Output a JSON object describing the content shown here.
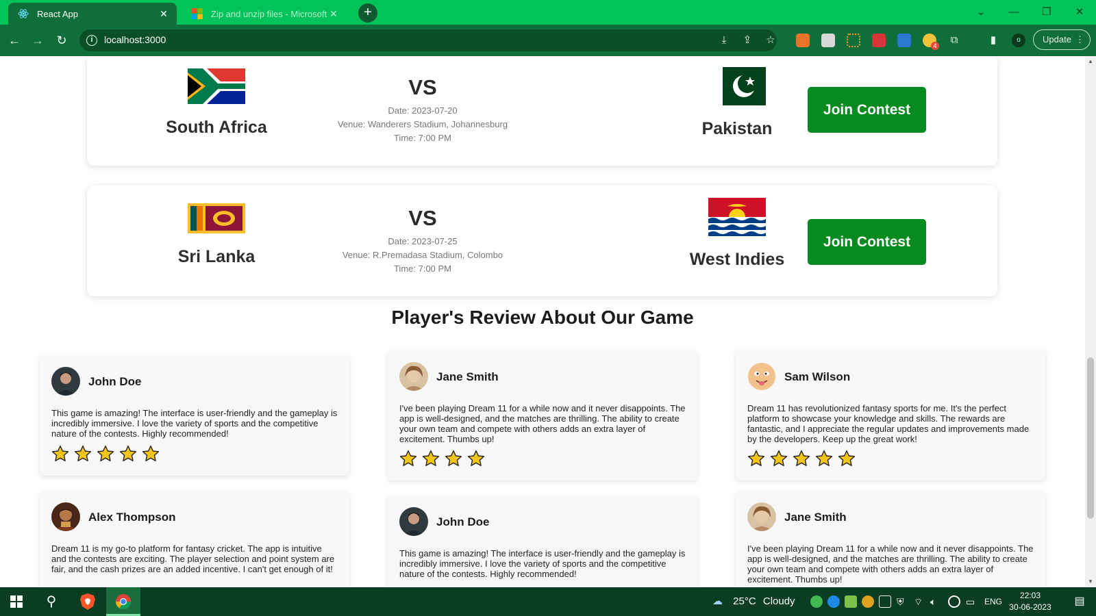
{
  "browser": {
    "tabs": [
      {
        "title": "React App",
        "active": true
      },
      {
        "title": "Zip and unzip files - Microsoft",
        "active": false
      }
    ],
    "new_tab_symbol": "+",
    "url": "localhost:3000",
    "update_label": "Update",
    "profile_initial": "o",
    "extension_badge": "4"
  },
  "matches": [
    {
      "team1": "South Africa",
      "team2": "Pakistan",
      "vs": "VS",
      "date": "Date: 2023-07-20",
      "venue": "Venue: Wanderers Stadium, Johannesburg",
      "time": "Time: 7:00 PM",
      "button": "Join Contest"
    },
    {
      "team1": "Sri Lanka",
      "team2": "West Indies",
      "vs": "VS",
      "date": "Date: 2023-07-25",
      "venue": "Venue: R.Premadasa Stadium, Colombo",
      "time": "Time: 7:00 PM",
      "button": "Join Contest"
    }
  ],
  "reviews_title": "Player's Review About Our Game",
  "reviews": [
    {
      "name": "John Doe",
      "text": "This game is amazing! The interface is user-friendly and the gameplay is incredibly immersive. I love the variety of sports and the competitive nature of the contests. Highly recommended!",
      "stars": 5
    },
    {
      "name": "Jane Smith",
      "text": "I've been playing Dream 11 for a while now and it never disappoints. The app is well-designed, and the matches are thrilling. The ability to create your own team and compete with others adds an extra layer of excitement. Thumbs up!",
      "stars": 4
    },
    {
      "name": "Sam Wilson",
      "text": "Dream 11 has revolutionized fantasy sports for me. It's the perfect platform to showcase your knowledge and skills. The rewards are fantastic, and I appreciate the regular updates and improvements made by the developers. Keep up the great work!",
      "stars": 5
    },
    {
      "name": "Alex Thompson",
      "text": "Dream 11 is my go-to platform for fantasy cricket. The app is intuitive and the contests are exciting. The player selection and point system are fair, and the cash prizes are an added incentive. I can't get enough of it!",
      "stars": 0
    },
    {
      "name": "John Doe",
      "text": "This game is amazing! The interface is user-friendly and the gameplay is incredibly immersive. I love the variety of sports and the competitive nature of the contests. Highly recommended!",
      "stars": 0
    },
    {
      "name": "Jane Smith",
      "text": "I've been playing Dream 11 for a while now and it never disappoints. The app is well-designed, and the matches are thrilling. The ability to create your own team and compete with others adds an extra layer of excitement. Thumbs up!",
      "stars": 0
    }
  ],
  "taskbar": {
    "weather_temp": "25°C",
    "weather_text": "Cloudy",
    "language": "ENG",
    "time": "22:03",
    "date": "30-06-2023"
  },
  "colors": {
    "browser_frame": "#01c35a",
    "toolbar": "#0f6e39",
    "join_button": "#078a1f",
    "star_fill": "#f5c518",
    "taskbar": "#0a3d22"
  },
  "icons": {
    "tab1_favicon": "react-icon",
    "tab2_favicon": "microsoft-icon",
    "back": "arrow-left-icon",
    "forward": "arrow-right-icon",
    "reload": "reload-icon",
    "star": "star-icon"
  }
}
